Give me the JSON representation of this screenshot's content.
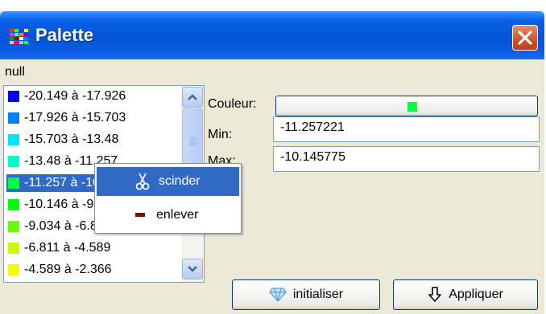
{
  "window": {
    "title": "Palette",
    "null_label": "null"
  },
  "palette_list": {
    "items": [
      {
        "label": "-20.149 à -17.926",
        "color": "#0000ff"
      },
      {
        "label": "-17.926 à -15.703",
        "color": "#0080ff"
      },
      {
        "label": "-15.703 à -13.48",
        "color": "#00e5ff"
      },
      {
        "label": "-13.48 à -11.257",
        "color": "#00ffc0"
      },
      {
        "label": "-11.257 à -10.146",
        "color": "#00ff3b",
        "selected": true
      },
      {
        "label": "-10.146 à -9.034",
        "color": "#00ff00"
      },
      {
        "label": "-9.034 à -6.811",
        "color": "#66ff00"
      },
      {
        "label": "-6.811 à -4.589",
        "color": "#c8ff00"
      },
      {
        "label": "-4.589 à -2.366",
        "color": "#f0ff00"
      }
    ]
  },
  "form": {
    "color_label": "Couleur:",
    "color_value": "#00ff3b",
    "min_label": "Min:",
    "min_value": "-11.257221",
    "max_label": "Max:",
    "max_value": "-10.145775"
  },
  "context_menu": {
    "split_label": "scinder",
    "remove_label": "enlever"
  },
  "buttons": {
    "reset_label": "initialiser",
    "apply_label": "Appliquer"
  },
  "icons": {
    "title": "palette-grid-icon",
    "close": "close-icon",
    "split": "scissors-icon",
    "remove": "minus-icon",
    "reset": "sparkle-icon",
    "apply": "arrow-down-icon"
  }
}
